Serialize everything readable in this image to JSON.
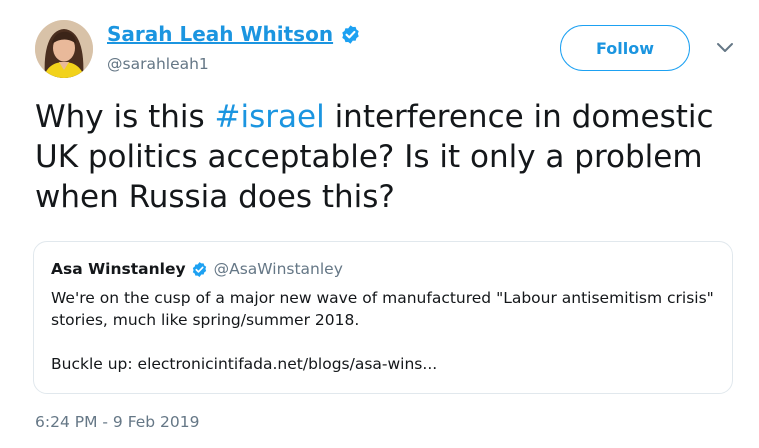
{
  "colors": {
    "link_blue": "#1b95e0",
    "badge_blue": "#1da1f2",
    "secondary_text": "#657786",
    "border": "#e1e8ed"
  },
  "author": {
    "name": "Sarah Leah Whitson",
    "handle": "@sarahleah1",
    "verified_icon": "verified-badge-icon",
    "avatar_icon": "profile-photo"
  },
  "actions": {
    "follow_label": "Follow",
    "more_icon": "chevron-down-icon"
  },
  "tweet": {
    "text_before": "Why is this ",
    "hashtag": "#israel",
    "text_after": " interference in domestic UK politics acceptable? Is it only a problem when Russia does this?"
  },
  "quoted_tweet": {
    "name": "Asa Winstanley",
    "handle": "@AsaWinstanley",
    "verified_icon": "verified-badge-icon",
    "line1": "We're on the cusp of a major new wave of manufactured \"Labour antisemitism crisis\" stories, much like spring/summer 2018.",
    "line2": "Buckle up: electronicintifada.net/blogs/asa-wins..."
  },
  "timestamp": "6:24 PM - 9 Feb 2019"
}
